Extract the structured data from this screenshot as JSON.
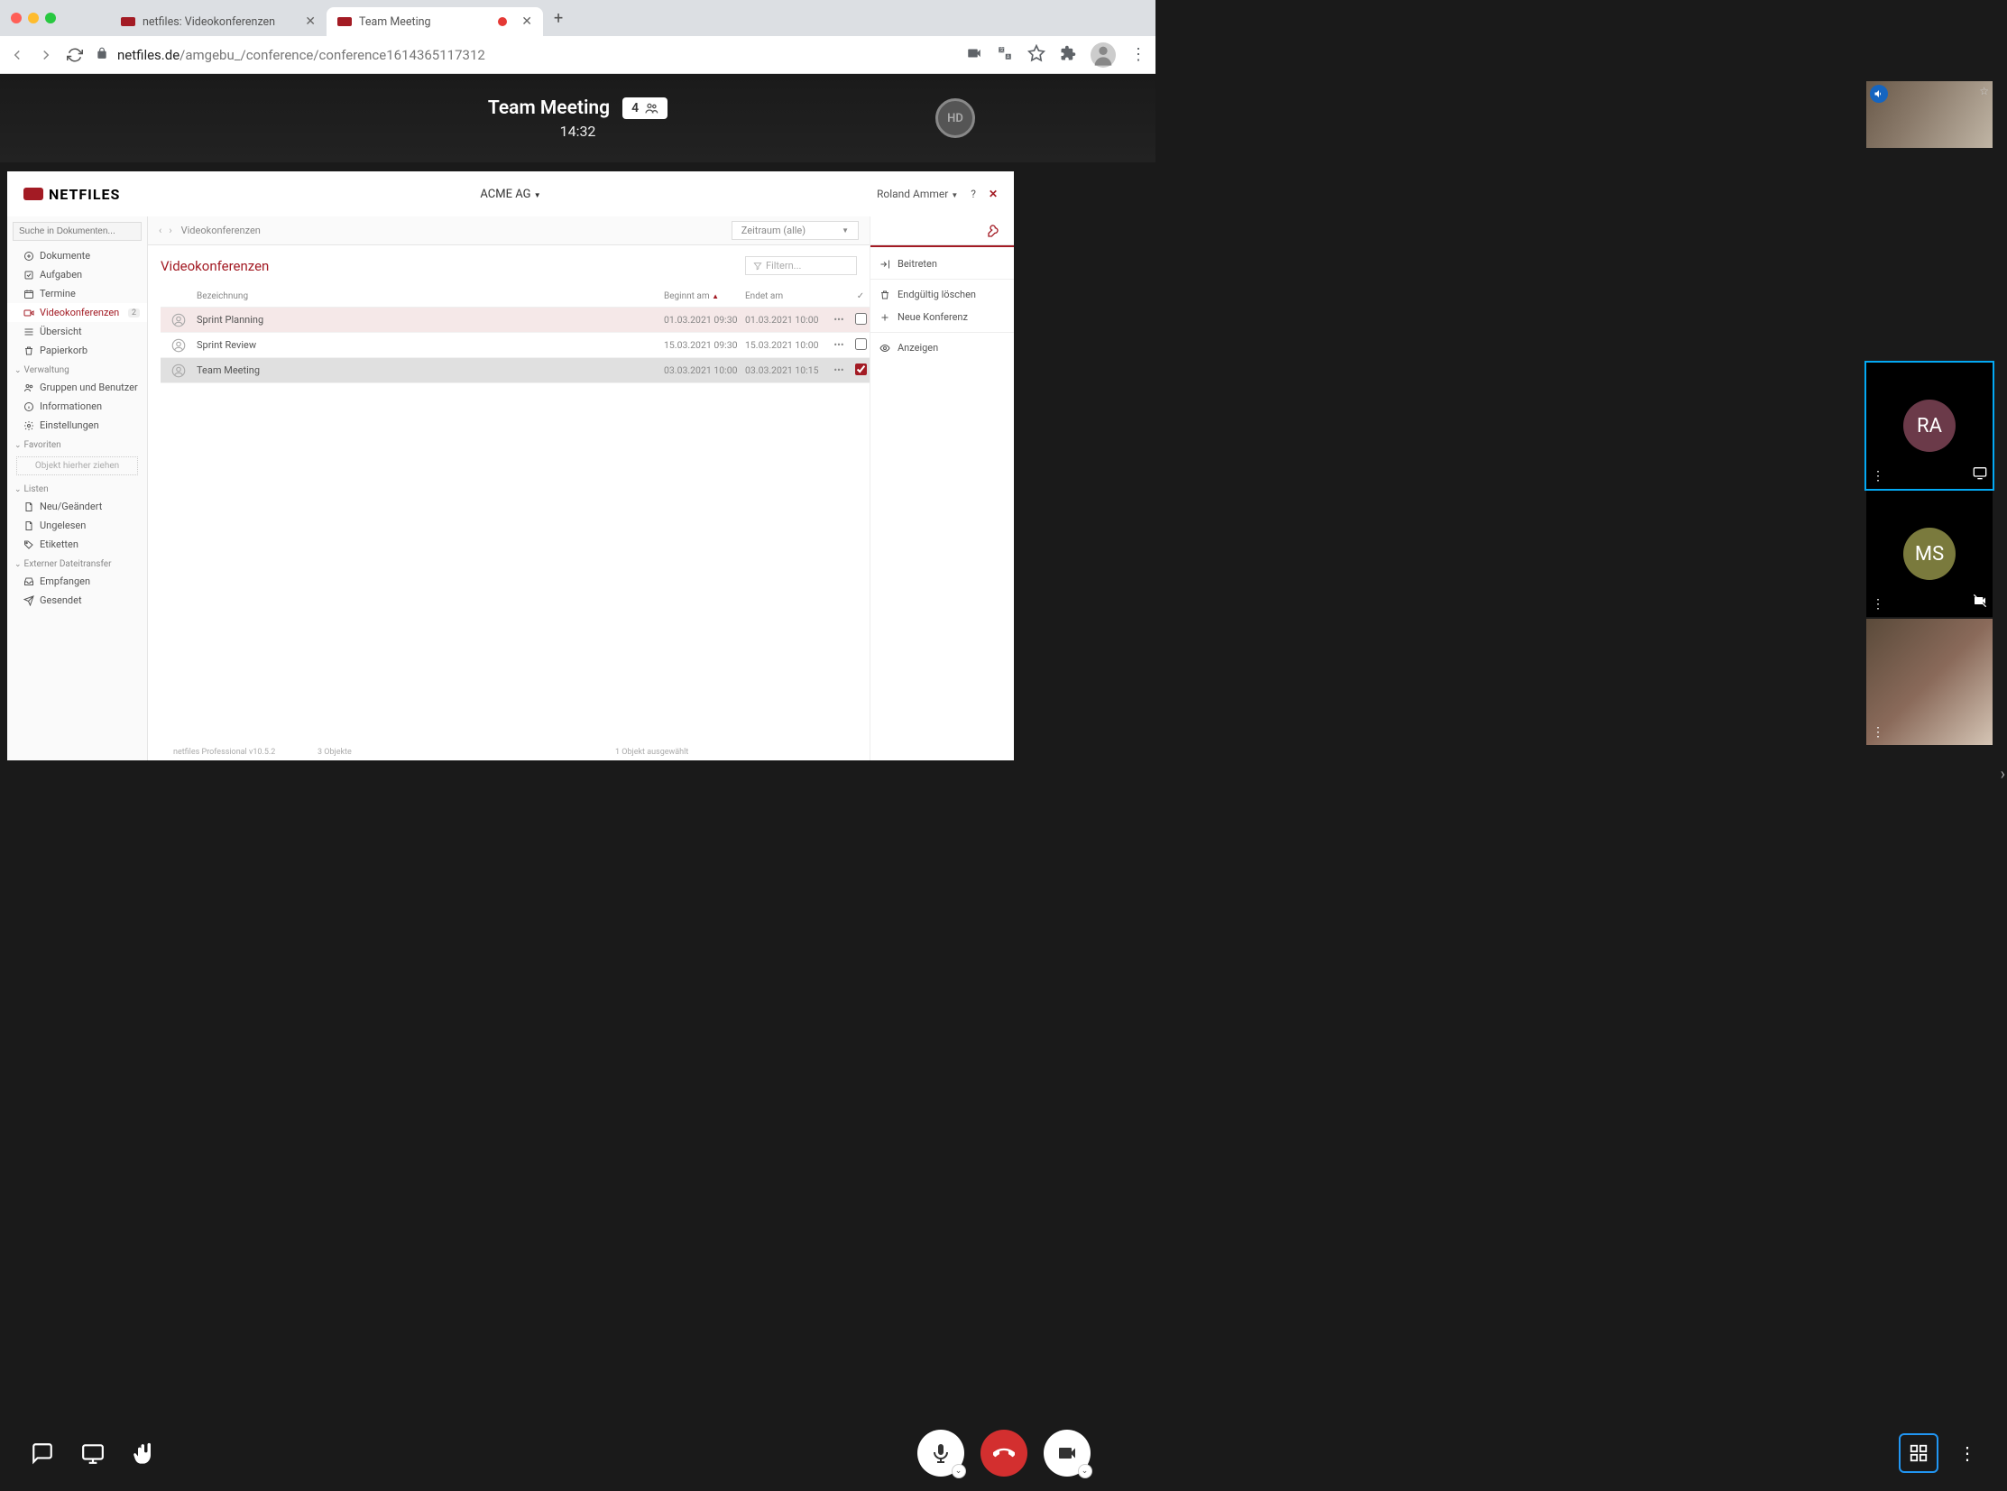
{
  "window": {
    "tabs": [
      {
        "label": "netfiles: Videokonferenzen",
        "active": false
      },
      {
        "label": "Team Meeting",
        "active": true
      }
    ],
    "traffic_lights": [
      "#ff5f57",
      "#febc2e",
      "#28c840"
    ]
  },
  "urlbar": {
    "host": "netfiles.de",
    "path": "/amgebu_/conference/conference1614365117312"
  },
  "conference": {
    "title": "Team Meeting",
    "participant_count": "4",
    "time": "14:32",
    "host_avatar_initials": "HD",
    "tiles": [
      {
        "kind": "webcam",
        "label": ""
      },
      {
        "kind": "avatar",
        "initials": "RA",
        "color": "#6b3a49",
        "selected": true,
        "screen": true
      },
      {
        "kind": "avatar",
        "initials": "MS",
        "color": "#7a7a3d",
        "selected": false,
        "cam_off": true
      },
      {
        "kind": "webcam",
        "label": ""
      }
    ]
  },
  "app": {
    "logo_text": "NETFILES",
    "org": "ACME AG",
    "user": "Roland Ammer",
    "search_placeholder": "Suche in Dokumenten...",
    "breadcrumb": "Videokonferenzen",
    "zeitraum": "Zeitraum (alle)",
    "page_title": "Videokonferenzen",
    "filter_placeholder": "Filtern...",
    "sidebar": {
      "top": [
        {
          "icon": "plus-circle",
          "label": "Dokumente"
        },
        {
          "icon": "check-square",
          "label": "Aufgaben"
        },
        {
          "icon": "calendar",
          "label": "Termine"
        },
        {
          "icon": "video",
          "label": "Videokonferenzen",
          "active": true,
          "badge": "2"
        },
        {
          "icon": "bars",
          "label": "Übersicht"
        },
        {
          "icon": "trash",
          "label": "Papierkorb"
        }
      ],
      "verwaltung_title": "Verwaltung",
      "verwaltung": [
        {
          "icon": "users",
          "label": "Gruppen und Benutzer"
        },
        {
          "icon": "info",
          "label": "Informationen"
        },
        {
          "icon": "gear",
          "label": "Einstellungen"
        }
      ],
      "favoriten_title": "Favoriten",
      "drop_hint": "Objekt hierher ziehen",
      "listen_title": "Listen",
      "listen": [
        {
          "icon": "doc",
          "label": "Neu/Geändert"
        },
        {
          "icon": "doc",
          "label": "Ungelesen"
        },
        {
          "icon": "tag",
          "label": "Etiketten"
        }
      ],
      "transfer_title": "Externer Dateitransfer",
      "transfer": [
        {
          "icon": "inbox",
          "label": "Empfangen"
        },
        {
          "icon": "send",
          "label": "Gesendet"
        }
      ]
    },
    "columns": {
      "name": "Bezeichnung",
      "begin": "Beginnt am",
      "end": "Endet am"
    },
    "rows": [
      {
        "name": "Sprint Planning",
        "begin": "01.03.2021 09:30",
        "end": "01.03.2021 10:00",
        "state": "sel",
        "checked": false
      },
      {
        "name": "Sprint Review",
        "begin": "15.03.2021 09:30",
        "end": "15.03.2021 10:00",
        "state": "",
        "checked": false
      },
      {
        "name": "Team Meeting",
        "begin": "03.03.2021 10:00",
        "end": "03.03.2021 10:15",
        "state": "pick",
        "checked": true
      }
    ],
    "actions": [
      {
        "icon": "enter",
        "label": "Beitreten"
      },
      {
        "sep": true
      },
      {
        "icon": "trash",
        "label": "Endgültig löschen"
      },
      {
        "icon": "plus",
        "label": "Neue Konferenz"
      },
      {
        "sep": true
      },
      {
        "icon": "eye",
        "label": "Anzeigen"
      }
    ],
    "status": {
      "version": "netfiles Professional v10.5.2",
      "count": "3 Objekte",
      "selected": "1 Objekt ausgewählt"
    }
  }
}
